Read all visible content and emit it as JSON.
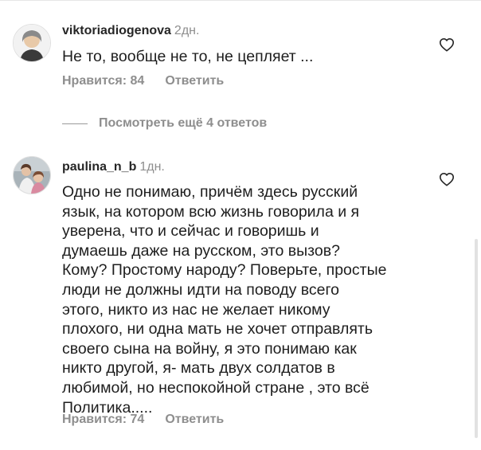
{
  "comments": [
    {
      "username": "viktoriadiogenova",
      "time": "2дн.",
      "text": "Не то, вообще не то, не цепляет ...",
      "likes": "Нравится: 84",
      "reply": "Ответить",
      "avatar_icon": "user-avatar",
      "like_icon": "heart-outline-icon"
    },
    {
      "username": "paulina_n_b",
      "time": "1дн.",
      "text": "Одно не понимаю, причём здесь русский\nязык, на котором всю жизнь говорила и я\nуверена, что и сейчас и говоришь и\nдумаешь даже на русском, это вызов?\nКому? Простому народу? Поверьте, простые\nлюди не должны идти на поводу всего\nэтого, никто из нас не желает никому\nплохого, ни одна мать не хочет отправлять\nсвоего сына на войну, я это понимаю как\nникто другой, я- мать двух солдатов в\nлюбимой, но неспокойной стране , это всё\nПолитика.....",
      "likes": "Нравится: 74",
      "reply": "Ответить",
      "avatar_icon": "user-avatar",
      "like_icon": "heart-outline-icon"
    }
  ],
  "view_replies": {
    "label": "Посмотреть ещё 4 ответов"
  },
  "colors": {
    "text_primary": "#262626",
    "text_secondary": "#8e8e8e",
    "background": "#ffffff"
  }
}
